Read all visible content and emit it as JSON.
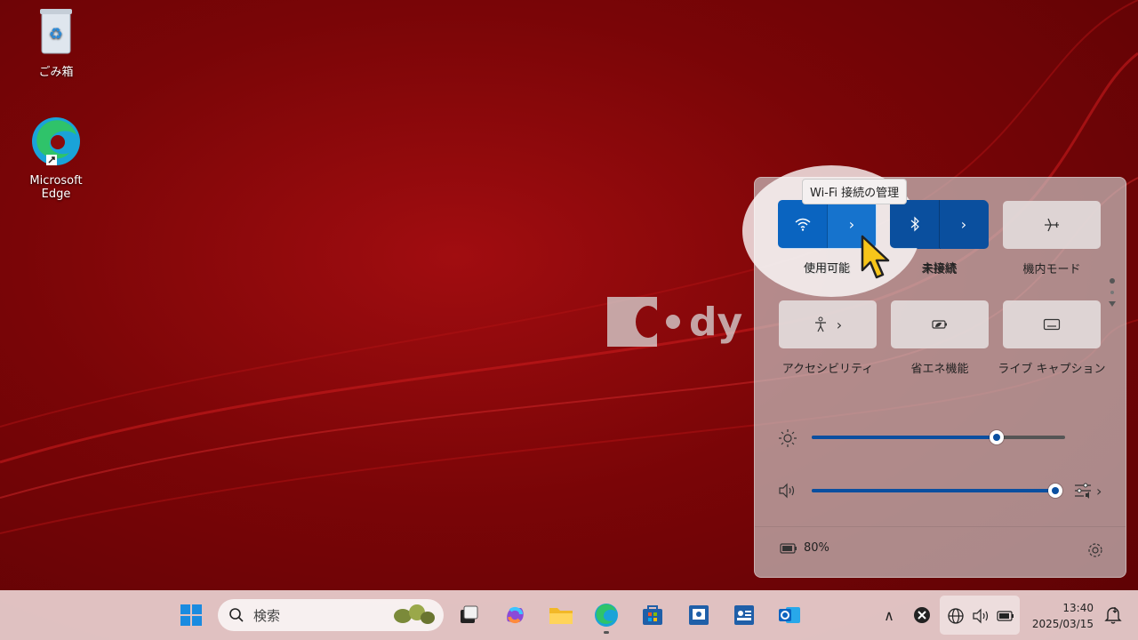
{
  "desktop": {
    "icons": [
      {
        "label": "ごみ箱",
        "icon": "recycle-bin-icon"
      },
      {
        "label": "Microsoft Edge",
        "icon": "edge-icon"
      }
    ],
    "watermark_text": "dy"
  },
  "quick_settings": {
    "tooltip": "Wi-Fi 接続の管理",
    "tiles": [
      {
        "label": "使用可能",
        "icon": "wifi-icon",
        "active": true,
        "has_chevron": true
      },
      {
        "label": "未接続",
        "icon": "bluetooth-icon",
        "active": true,
        "has_chevron": true
      },
      {
        "label": "機内モード",
        "icon": "airplane-icon",
        "active": false
      },
      {
        "label": "アクセシビリティ",
        "icon": "accessibility-icon",
        "active": false,
        "has_chevron": true
      },
      {
        "label": "省エネ機能",
        "icon": "energy-saver-icon",
        "active": false
      },
      {
        "label": "ライブ キャプション",
        "icon": "live-captions-icon",
        "active": false
      }
    ],
    "brightness_level": 0.73,
    "volume_level": 1.0,
    "battery_text": "80%"
  },
  "taskbar": {
    "search_placeholder": "検索",
    "pinned": [
      "start-icon",
      "task-view-icon",
      "copilot-icon",
      "file-explorer-icon",
      "edge-icon",
      "store-icon",
      "app-icon",
      "contacts-icon",
      "outlook-icon"
    ],
    "clock_time": "13:40",
    "clock_date": "2025/03/15"
  },
  "colors": {
    "accent": "#0a64c0",
    "wallpaper": "#7a0507"
  }
}
